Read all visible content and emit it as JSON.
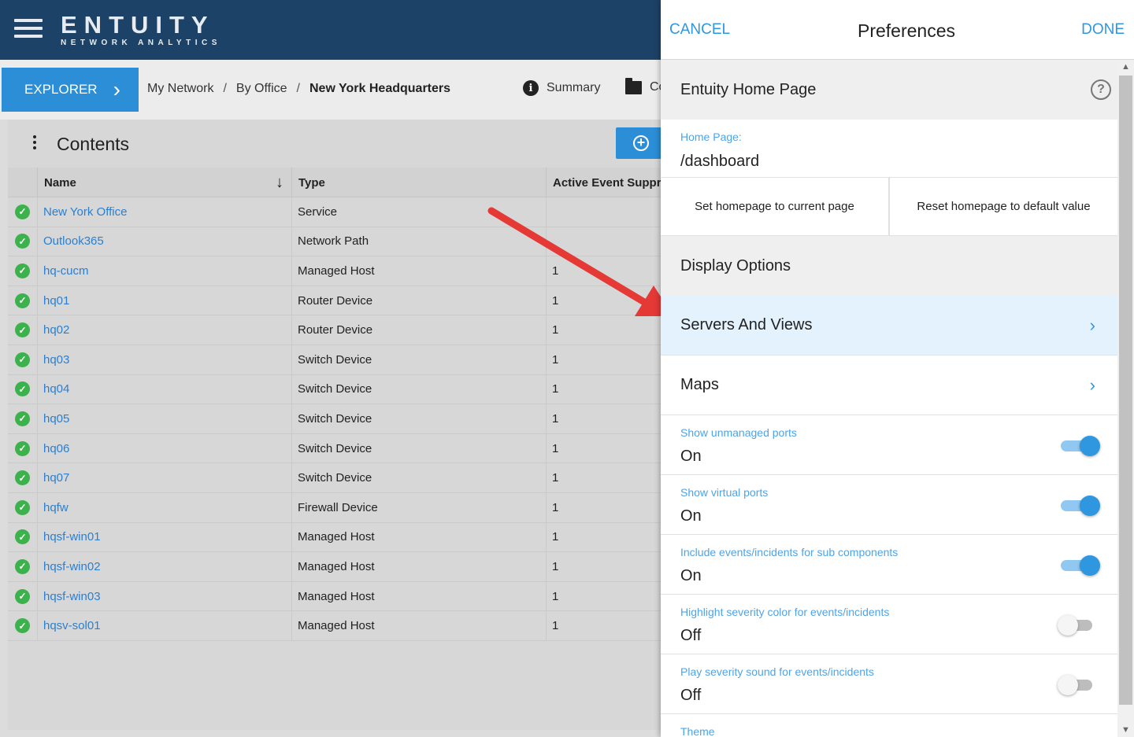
{
  "app": {
    "brand": "ENTUITY",
    "brand_sub": "NETWORK ANALYTICS"
  },
  "nav": {
    "explorer_label": "EXPLORER",
    "breadcrumb": [
      "My Network",
      "By Office",
      "New York Headquarters"
    ],
    "breadcrumb_sep": "/",
    "tab_summary": "Summary",
    "tab_contents": "Co"
  },
  "contents": {
    "title": "Contents",
    "columns": [
      "Name",
      "Type",
      "Active Event Suppres"
    ],
    "rows": [
      {
        "name": "New York Office",
        "type": "Service",
        "active": ""
      },
      {
        "name": "Outlook365",
        "type": "Network Path",
        "active": ""
      },
      {
        "name": "hq-cucm",
        "type": "Managed Host",
        "active": "1"
      },
      {
        "name": "hq01",
        "type": "Router Device",
        "active": "1"
      },
      {
        "name": "hq02",
        "type": "Router Device",
        "active": "1"
      },
      {
        "name": "hq03",
        "type": "Switch Device",
        "active": "1"
      },
      {
        "name": "hq04",
        "type": "Switch Device",
        "active": "1"
      },
      {
        "name": "hq05",
        "type": "Switch Device",
        "active": "1"
      },
      {
        "name": "hq06",
        "type": "Switch Device",
        "active": "1"
      },
      {
        "name": "hq07",
        "type": "Switch Device",
        "active": "1"
      },
      {
        "name": "hqfw",
        "type": "Firewall Device",
        "active": "1"
      },
      {
        "name": "hqsf-win01",
        "type": "Managed Host",
        "active": "1"
      },
      {
        "name": "hqsf-win02",
        "type": "Managed Host",
        "active": "1"
      },
      {
        "name": "hqsf-win03",
        "type": "Managed Host",
        "active": "1"
      },
      {
        "name": "hqsv-sol01",
        "type": "Managed Host",
        "active": "1"
      }
    ]
  },
  "prefs": {
    "cancel": "CANCEL",
    "title": "Preferences",
    "done": "DONE",
    "section_home": "Entuity Home Page",
    "home_label": "Home Page:",
    "home_value": "/dashboard",
    "btn_set_home": "Set homepage to current page",
    "btn_reset_home": "Reset homepage to default value",
    "section_display": "Display Options",
    "nav_servers": "Servers And Views",
    "nav_maps": "Maps",
    "toggles": [
      {
        "label": "Show unmanaged ports",
        "value": "On"
      },
      {
        "label": "Show virtual ports",
        "value": "On"
      },
      {
        "label": "Include events/incidents for sub components",
        "value": "On"
      },
      {
        "label": "Highlight severity color for events/incidents",
        "value": "Off"
      },
      {
        "label": "Play severity sound for events/incidents",
        "value": "Off"
      }
    ],
    "theme_label": "Theme"
  },
  "colors": {
    "topbar": "#1d4267",
    "accent": "#2e97e0",
    "status_ok": "#3cb24c",
    "annotation_arrow": "#e53935"
  },
  "icons": [
    "hamburger-icon",
    "chevron-right-icon",
    "info-icon",
    "folder-icon",
    "kebab-icon",
    "add-circle-icon",
    "sort-down-icon",
    "status-ok-icon",
    "help-icon"
  ]
}
